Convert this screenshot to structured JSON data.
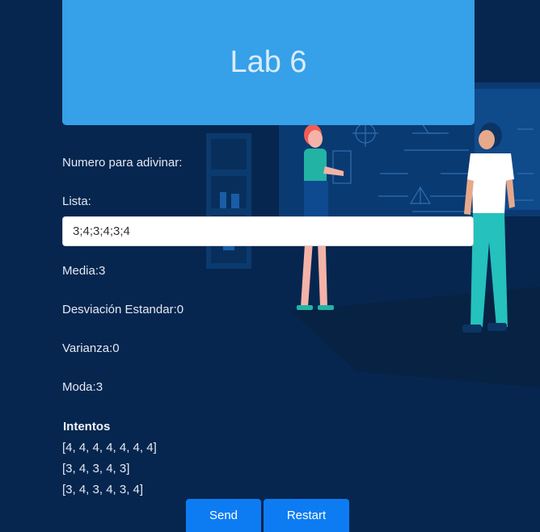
{
  "header": {
    "title": "Lab 6"
  },
  "form": {
    "guess_label": "Numero para adivinar:",
    "list_label": "Lista:",
    "list_value": "3;4;3;4;3;4"
  },
  "stats": {
    "mean": "Media:3",
    "std_dev": "Desviación Estandar:0",
    "variance": "Varianza:0",
    "mode": "Moda:3"
  },
  "attempts": {
    "title": "Intentos",
    "items": [
      "[4, 4, 4, 4, 4, 4, 4]",
      "[3, 4, 3, 4, 3]",
      "[3, 4, 3, 4, 3, 4]"
    ]
  },
  "buttons": {
    "send": "Send",
    "restart": "Restart"
  },
  "colors": {
    "background": "#06264f",
    "header": "#36a0e8",
    "button": "#0d7cf2"
  }
}
